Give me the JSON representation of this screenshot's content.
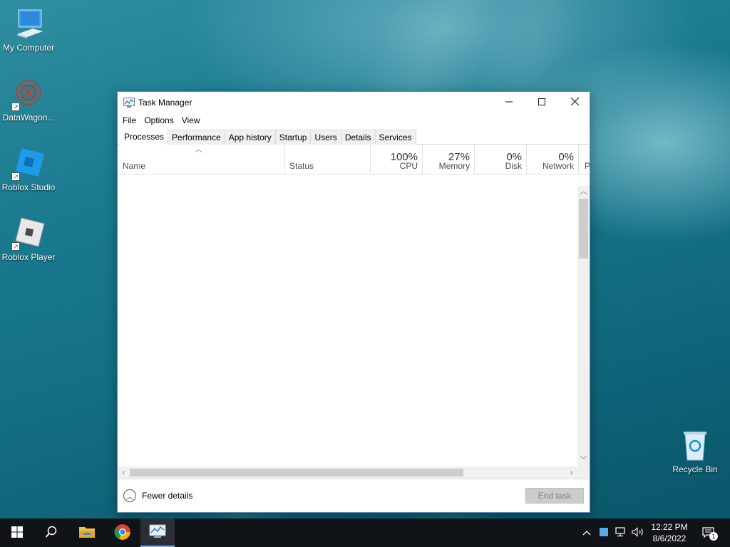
{
  "desktop": {
    "icons": [
      {
        "label": "My Computer"
      },
      {
        "label": "DataWagon..."
      },
      {
        "label": "Roblox Studio"
      },
      {
        "label": "Roblox Player"
      },
      {
        "label": "Recycle Bin"
      }
    ]
  },
  "window": {
    "title": "Task Manager",
    "menu": [
      "File",
      "Options",
      "View"
    ],
    "tabs": [
      "Processes",
      "Performance",
      "App history",
      "Startup",
      "Users",
      "Details",
      "Services"
    ],
    "active_tab": "Processes",
    "columns": {
      "name": {
        "label": "Name"
      },
      "status": {
        "label": "Status"
      },
      "cpu": {
        "label": "CPU",
        "pct": "100%"
      },
      "memory": {
        "label": "Memory",
        "pct": "27%"
      },
      "disk": {
        "label": "Disk",
        "pct": "0%"
      },
      "network": {
        "label": "Network",
        "pct": "0%"
      },
      "overflow": {
        "label": "P"
      }
    },
    "footer": {
      "fewer_details": "Fewer details",
      "end_task": "End task"
    }
  },
  "taskbar": {
    "clock_time": "12:22 PM",
    "clock_date": "8/6/2022",
    "notification_count": "1"
  },
  "colors": {
    "taskbar": "#101318",
    "window_border": "#5a8fb0",
    "end_task_bg": "#cccccc"
  }
}
